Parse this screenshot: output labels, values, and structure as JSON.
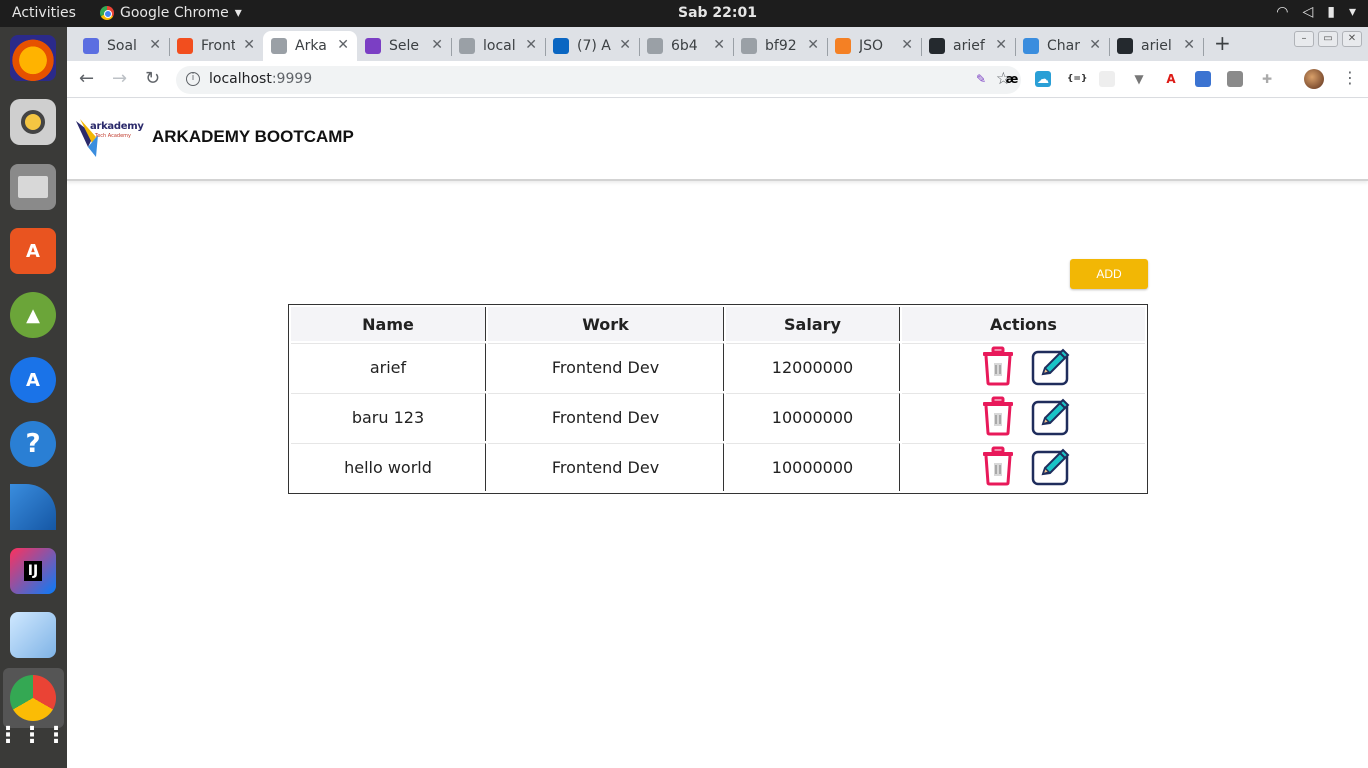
{
  "os": {
    "activities": "Activities",
    "app_name": "Google Chrome",
    "clock": "Sab 22:01"
  },
  "browser": {
    "tabs": [
      {
        "title": "Soal",
        "color": "#5b6ee1",
        "active": false
      },
      {
        "title": "Front",
        "color": "#f24e1e",
        "active": false
      },
      {
        "title": "Arka",
        "color": "#9aa0a6",
        "active": true
      },
      {
        "title": "Sele",
        "color": "#7b3fc4",
        "active": false
      },
      {
        "title": "local",
        "color": "#9aa0a6",
        "active": false
      },
      {
        "title": "(7) A",
        "color": "#0a66c2",
        "active": false
      },
      {
        "title": "6b4",
        "color": "#9aa0a6",
        "active": false
      },
      {
        "title": "bf92",
        "color": "#9aa0a6",
        "active": false
      },
      {
        "title": "JSO",
        "color": "#f48024",
        "active": false
      },
      {
        "title": "arief",
        "color": "#24292e",
        "active": false
      },
      {
        "title": "Char",
        "color": "#3a8dde",
        "active": false
      },
      {
        "title": "ariel",
        "color": "#24292e",
        "active": false
      }
    ],
    "url_host": "localhost",
    "url_port": ":9999"
  },
  "site": {
    "logo_text": "arkademy",
    "logo_sub": "Tech Academy",
    "title": "ARKADEMY BOOTCAMP",
    "add_label": "ADD"
  },
  "table": {
    "headers": [
      "Name",
      "Work",
      "Salary",
      "Actions"
    ],
    "rows": [
      {
        "name": "arief",
        "work": "Frontend Dev",
        "salary": "12000000"
      },
      {
        "name": "baru 123",
        "work": "Frontend Dev",
        "salary": "10000000"
      },
      {
        "name": "hello world",
        "work": "Frontend Dev",
        "salary": "10000000"
      }
    ]
  },
  "colors": {
    "add_button": "#f2b705",
    "delete_icon": "#e8195a",
    "edit_icon": "#1f2d5c",
    "pencil": "#19c3c6"
  }
}
